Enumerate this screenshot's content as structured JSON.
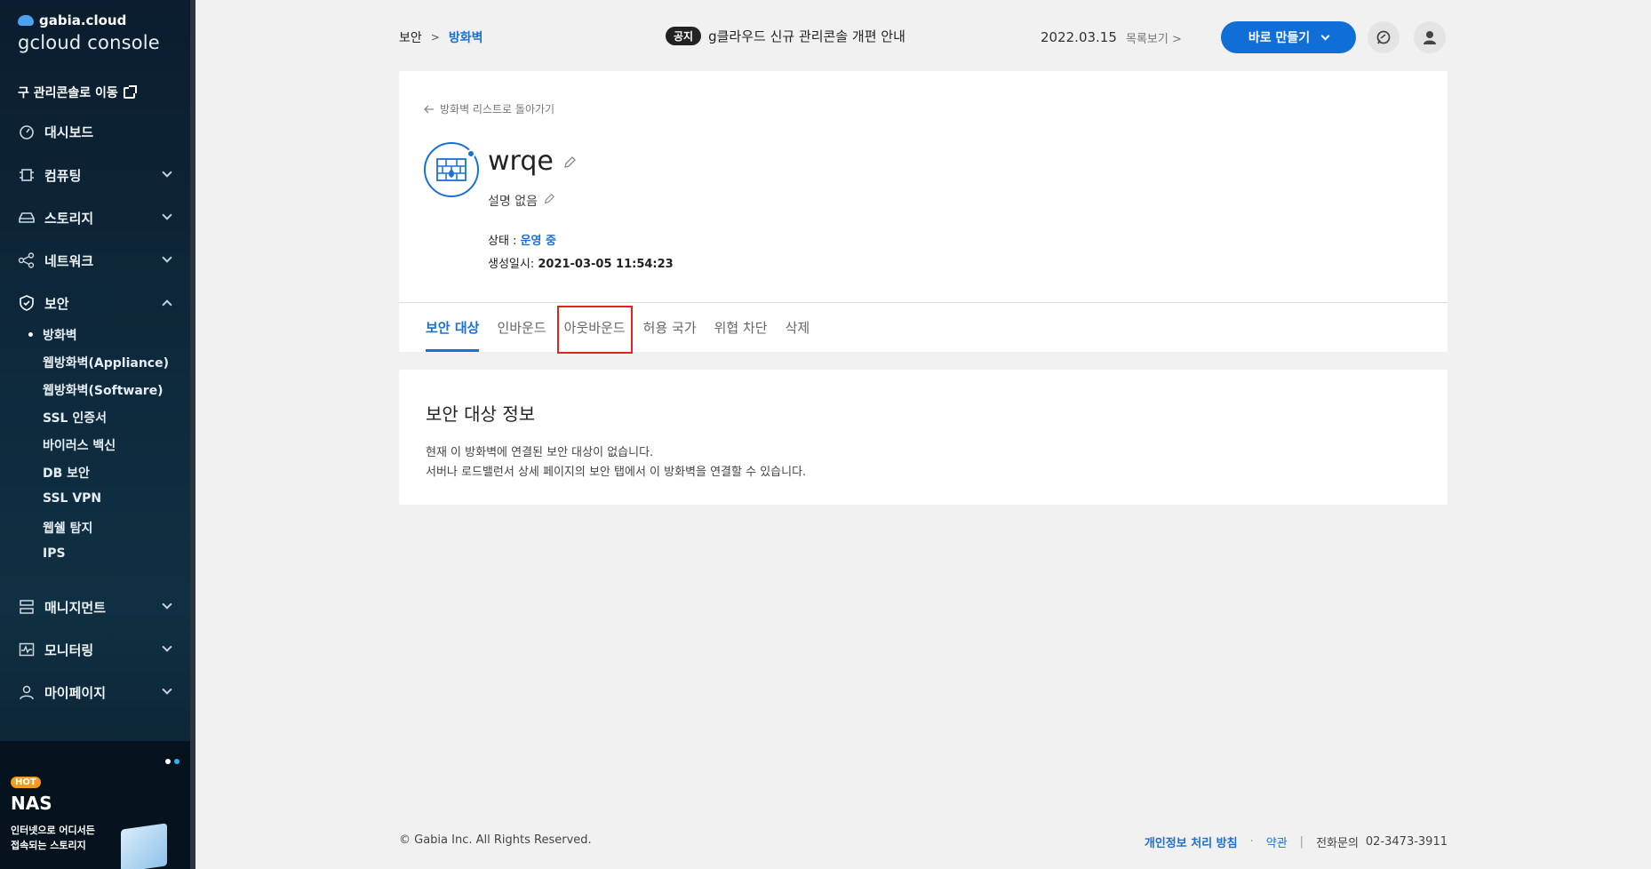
{
  "sidebar": {
    "brand": "gabia.cloud",
    "product": "gcloud console",
    "old_console": "구 관리콘솔로 이동",
    "items": [
      {
        "label": "대시보드"
      },
      {
        "label": "컴퓨팅"
      },
      {
        "label": "스토리지"
      },
      {
        "label": "네트워크"
      },
      {
        "label": "보안"
      },
      {
        "label": "매니지먼트"
      },
      {
        "label": "모니터링"
      },
      {
        "label": "마이페이지"
      }
    ],
    "security_sub": [
      "방화벽",
      "웹방화벽(Appliance)",
      "웹방화벽(Software)",
      "SSL 인증서",
      "바이러스 백신",
      "DB 보안",
      "SSL VPN",
      "웹쉘 탐지",
      "IPS"
    ],
    "banner": {
      "badge": "HOT",
      "title": "NAS",
      "desc_line1": "인터넷으로 어디서든",
      "desc_line2": "접속되는 스토리지"
    }
  },
  "header": {
    "breadcrumb_parent": "보안",
    "breadcrumb_sep": ">",
    "breadcrumb_current": "방화벽",
    "notice_badge": "공지",
    "notice_text": "g클라우드 신규 관리콘솔 개편 안내",
    "notice_date": "2022.03.15",
    "notice_list": "목록보기 >",
    "create_label": "바로 만들기"
  },
  "detail": {
    "back_label": "방화벽 리스트로 돌아가기",
    "name": "wrqe",
    "description": "설명 없음",
    "status_label": "상태 : ",
    "status_value": "운영 중",
    "created_label": "생성일시: ",
    "created_value": "2021-03-05 11:54:23",
    "tabs": [
      "보안 대상",
      "인바운드",
      "아웃바운드",
      "허용 국가",
      "위협 차단",
      "삭제"
    ]
  },
  "info": {
    "title": "보안 대상 정보",
    "line1": "현재 이 방화벽에 연결된 보안 대상이 없습니다.",
    "line2": "서버나 로드밸런서 상세 페이지의 보안 탭에서 이 방화벽을 연결할 수 있습니다."
  },
  "footer": {
    "copyright": "© Gabia Inc. All Rights Reserved.",
    "privacy": "개인정보 처리 방침",
    "dot": "·",
    "terms": "약관",
    "bar": "|",
    "phone_label": "전화문의",
    "phone": "02-3473-3911"
  },
  "colors": {
    "accent": "#1a6fd8",
    "sidebar_bg": "#0b1d2e",
    "highlight": "#e02424"
  }
}
